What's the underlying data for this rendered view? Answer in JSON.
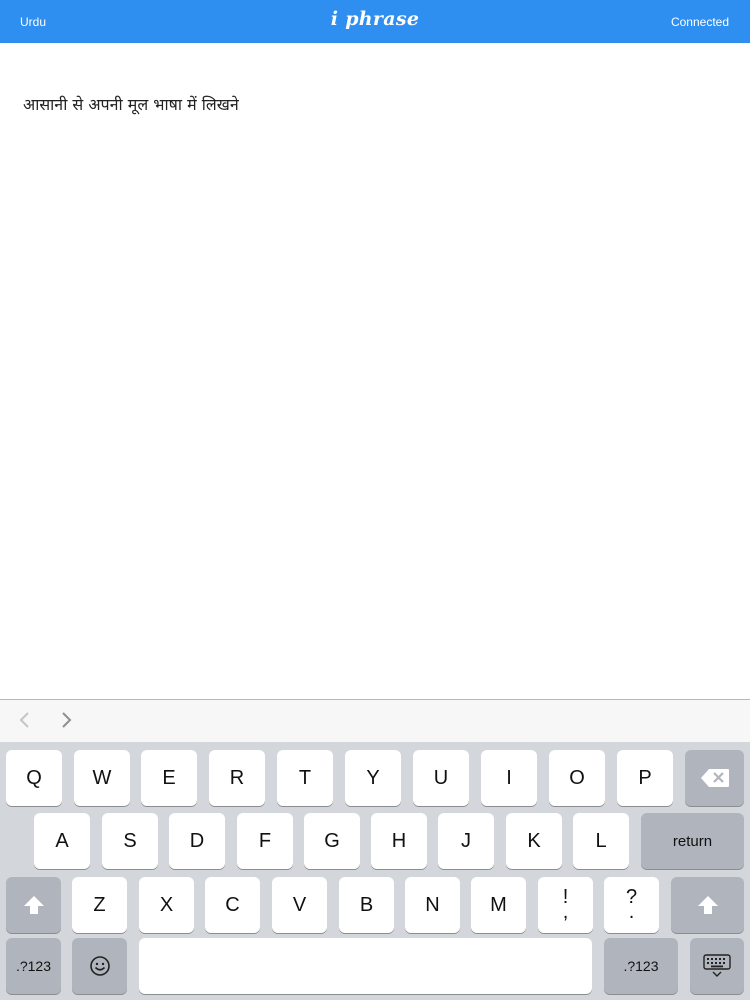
{
  "header": {
    "left_label": "Urdu",
    "title": "i phrase",
    "right_label": "Connected",
    "bar_color": "#2e8ff0"
  },
  "editor": {
    "text": "आसानी से अपनी मूल भाषा में लिखने"
  },
  "accessory": {
    "back_icon": "chevron-left-icon",
    "forward_icon": "chevron-right-icon"
  },
  "keyboard": {
    "row1": [
      "Q",
      "W",
      "E",
      "R",
      "T",
      "Y",
      "U",
      "I",
      "O",
      "P"
    ],
    "row2": [
      "A",
      "S",
      "D",
      "F",
      "G",
      "H",
      "J",
      "K",
      "L"
    ],
    "row3": [
      "Z",
      "X",
      "C",
      "V",
      "B",
      "N",
      "M"
    ],
    "punct1": {
      "top": "!",
      "bottom": ","
    },
    "punct2": {
      "top": "?",
      "bottom": "."
    },
    "return_label": "return",
    "numbers_left_label": ".?123",
    "numbers_right_label": ".?123",
    "icons": {
      "backspace": "backspace-icon",
      "shift": "shift-icon",
      "emoji": "emoji-icon",
      "dismiss": "keyboard-dismiss-icon"
    }
  }
}
